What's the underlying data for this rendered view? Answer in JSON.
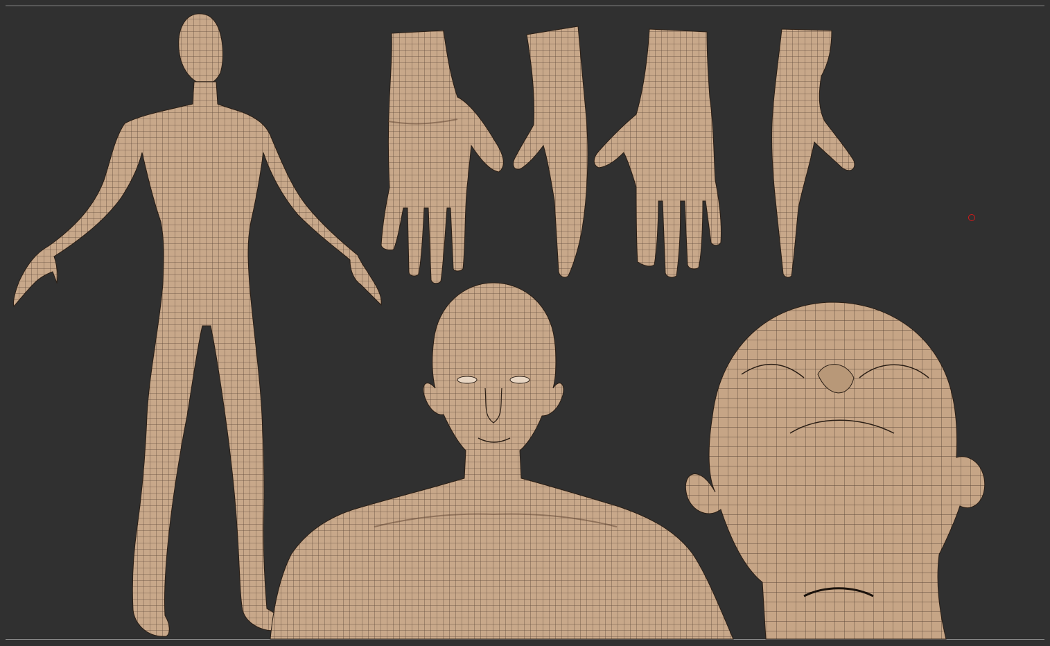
{
  "viewport": {
    "background_color": "#303030",
    "frame_line_color": "#8a8a8a",
    "skin_color": "#c8a88a",
    "wire_color": "#3a2a1e",
    "cursor_marker_color": "#d21a1a"
  },
  "models": [
    {
      "name": "full-body-front"
    },
    {
      "name": "hand-back"
    },
    {
      "name": "hand-side"
    },
    {
      "name": "hand-palm"
    },
    {
      "name": "hand-side-thumb"
    },
    {
      "name": "head-torso-front"
    },
    {
      "name": "head-below"
    }
  ]
}
